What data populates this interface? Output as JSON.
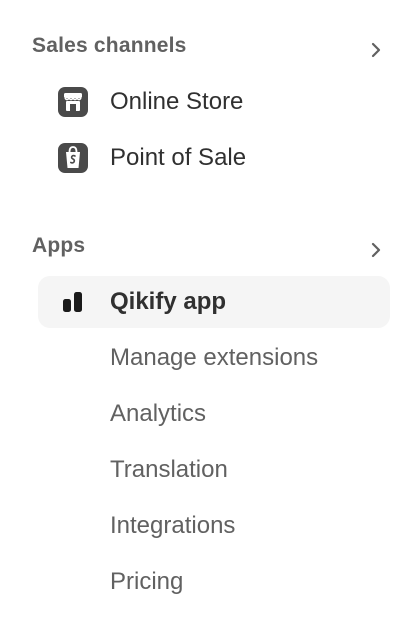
{
  "sales_channels": {
    "title": "Sales channels",
    "items": [
      {
        "label": "Online Store",
        "icon": "storefront-icon"
      },
      {
        "label": "Point of Sale",
        "icon": "shopping-bag-icon"
      }
    ]
  },
  "apps": {
    "title": "Apps",
    "active_app": {
      "label": "Qikify app",
      "icon": "qikify-logo-icon"
    },
    "subitems": [
      {
        "label": "Manage extensions"
      },
      {
        "label": "Analytics"
      },
      {
        "label": "Translation"
      },
      {
        "label": "Integrations"
      },
      {
        "label": "Pricing"
      }
    ]
  },
  "colors": {
    "section_title": "#616161",
    "item_text": "#303030",
    "subitem_text": "#616161",
    "active_bg": "#f5f5f5"
  }
}
